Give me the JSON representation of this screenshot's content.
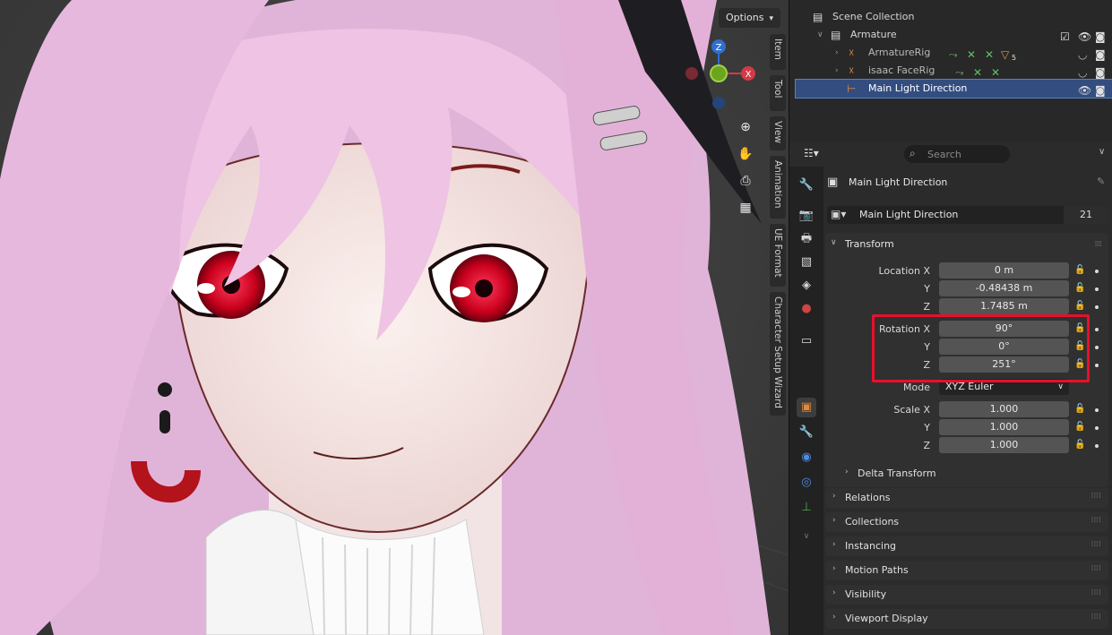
{
  "viewport": {
    "options_label": "Options",
    "side_tabs": [
      "Item",
      "Tool",
      "View",
      "Animation",
      "UE Format",
      "Character Setup Wizard"
    ],
    "gizmo": {
      "z": "Z",
      "x": "X"
    },
    "nav_icons": [
      "zoom-icon",
      "hand-pan-icon",
      "camera-icon",
      "grid-icon"
    ]
  },
  "outliner": {
    "rows": [
      {
        "label": "Scene Collection"
      },
      {
        "label": "Armature"
      },
      {
        "label": "ArmatureRig",
        "badge": "5"
      },
      {
        "label": "isaac FaceRig"
      },
      {
        "label": "Main Light Direction"
      }
    ]
  },
  "properties": {
    "search_placeholder": "Search",
    "object_name": "Main Light Direction",
    "data_name": "Main Light Direction",
    "data_users": "21",
    "transform": {
      "title": "Transform",
      "location_label": "Location X",
      "location": [
        "0 m",
        "-0.48438 m",
        "1.7485 m"
      ],
      "rotation_label": "Rotation X",
      "rotation": [
        "90°",
        "0°",
        "251°"
      ],
      "mode_label": "Mode",
      "mode_value": "XYZ Euler",
      "scale_label": "Scale X",
      "scale": [
        "1.000",
        "1.000",
        "1.000"
      ],
      "axis_y": "Y",
      "axis_z": "Z",
      "delta": "Delta Transform"
    },
    "sections": [
      "Relations",
      "Collections",
      "Instancing",
      "Motion Paths",
      "Visibility",
      "Viewport Display"
    ]
  },
  "colors": {
    "selection": "#334d80",
    "highlight": "#e8102a",
    "gizmo_z": "#2f6fcf",
    "gizmo_x": "#d23a47",
    "gizmo_y": "#6aa51b"
  }
}
